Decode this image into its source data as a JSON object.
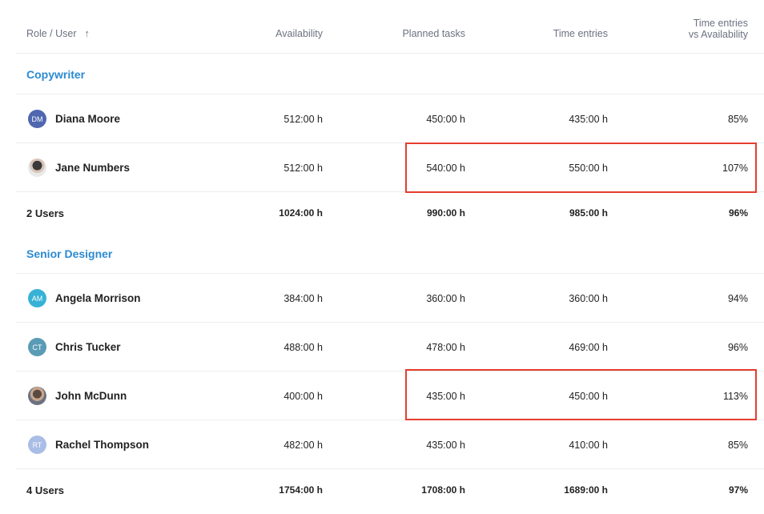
{
  "header": {
    "role_user": "Role / User",
    "sort_icon": "arrow-up-icon",
    "availability": "Availability",
    "planned_tasks": "Planned tasks",
    "time_entries": "Time entries",
    "ratio_line1": "Time entries",
    "ratio_line2": "vs Availability"
  },
  "groups": [
    {
      "title": "Copywriter",
      "users": [
        {
          "initials": "DM",
          "avatar_color": "#4f67b0",
          "name": "Diana Moore",
          "availability": "512:00 h",
          "planned": "450:00 h",
          "time": "435:00 h",
          "ratio": "85%"
        },
        {
          "initials": "",
          "avatar_color": "#d9c4b8",
          "name": "Jane Numbers",
          "availability": "512:00 h",
          "planned": "540:00 h",
          "time": "550:00 h",
          "ratio": "107%"
        }
      ],
      "total": {
        "label": "2 Users",
        "availability": "1024:00 h",
        "planned": "990:00 h",
        "time": "985:00 h",
        "ratio": "96%"
      }
    },
    {
      "title": "Senior Designer",
      "users": [
        {
          "initials": "AM",
          "avatar_color": "#37b2d6",
          "name": "Angela Morrison",
          "availability": "384:00 h",
          "planned": "360:00 h",
          "time": "360:00 h",
          "ratio": "94%"
        },
        {
          "initials": "CT",
          "avatar_color": "#5a9bb5",
          "name": "Chris Tucker",
          "availability": "488:00 h",
          "planned": "478:00 h",
          "time": "469:00 h",
          "ratio": "96%"
        },
        {
          "initials": "",
          "avatar_color": "#5a4a3f",
          "name": "John McDunn",
          "availability": "400:00 h",
          "planned": "435:00 h",
          "time": "450:00 h",
          "ratio": "113%"
        },
        {
          "initials": "RT",
          "avatar_color": "#a9bde6",
          "name": "Rachel Thompson",
          "availability": "482:00 h",
          "planned": "435:00 h",
          "time": "410:00 h",
          "ratio": "85%"
        }
      ],
      "total": {
        "label": "4 Users",
        "availability": "1754:00 h",
        "planned": "1708:00 h",
        "time": "1689:00 h",
        "ratio": "97%"
      }
    }
  ],
  "colors": {
    "group_title": "#2b8ad1",
    "highlight_border": "#e53d2f"
  }
}
